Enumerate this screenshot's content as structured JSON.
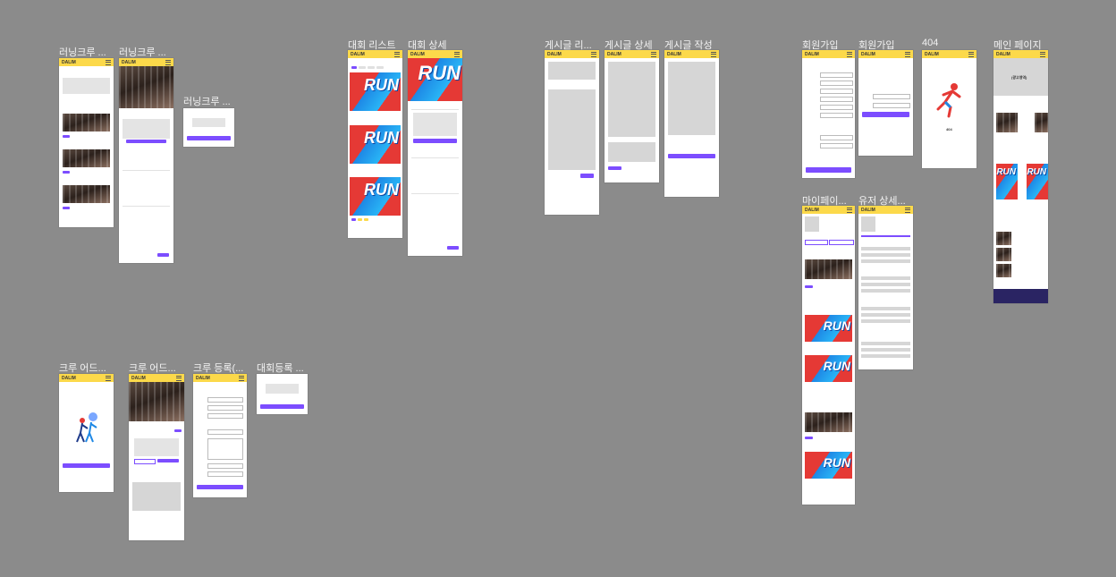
{
  "app_logo": "DALIM",
  "labels": {
    "crew_list": "러닝크루 ...",
    "crew_detail": "러닝크루 ...",
    "crew_modal": "러닝크루 ...",
    "race_list": "대회 리스트",
    "race_detail": "대회 상세",
    "post_list": "게시글 리...",
    "post_detail": "게시글 상세",
    "post_write": "게시글 작성",
    "signup1": "회원가입",
    "signup2": "회원가입",
    "notfound": "404",
    "main": "메인 페이지",
    "mypage": "마이페이...",
    "user_detail": "유저 상세...",
    "crew_admin1": "크루 어드...",
    "crew_admin2": "크루 어드...",
    "crew_register": "크루 등록(...",
    "race_register": "대회등록 ..."
  },
  "poster_text": "RUN",
  "nf_code": "404",
  "main_banner": "(광고영역)"
}
